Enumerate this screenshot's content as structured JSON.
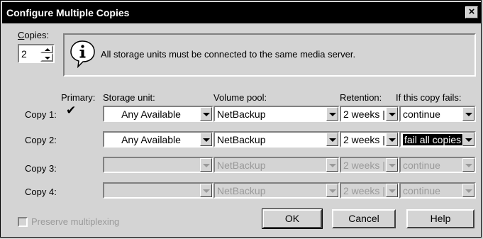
{
  "window": {
    "title": "Configure Multiple Copies"
  },
  "copies": {
    "label": "Copies:",
    "value": "2"
  },
  "info": {
    "message": "All storage units must be connected to the same media server."
  },
  "columns": {
    "primary": "Primary:",
    "storage_unit": "Storage unit:",
    "volume_pool": "Volume pool:",
    "retention": "Retention:",
    "if_fails": "If this copy fails:"
  },
  "rows": [
    {
      "label": "Copy 1:",
      "primary_mark": "✔",
      "storage_unit": "Any Available",
      "volume_pool": "NetBackup",
      "retention": "2 weeks |",
      "if_fails": "continue"
    },
    {
      "label": "Copy 2:",
      "storage_unit": "Any Available",
      "volume_pool": "NetBackup",
      "retention": "2 weeks |",
      "if_fails": "fail all copies"
    },
    {
      "label": "Copy 3:",
      "storage_unit": "",
      "volume_pool": "NetBackup",
      "retention": "2 weeks |",
      "if_fails": "continue"
    },
    {
      "label": "Copy 4:",
      "storage_unit": "",
      "volume_pool": "NetBackup",
      "retention": "2 weeks |",
      "if_fails": "continue"
    }
  ],
  "preserve": {
    "label": "Preserve multiplexing"
  },
  "buttons": {
    "ok": "OK",
    "cancel": "Cancel",
    "help": "Help"
  }
}
